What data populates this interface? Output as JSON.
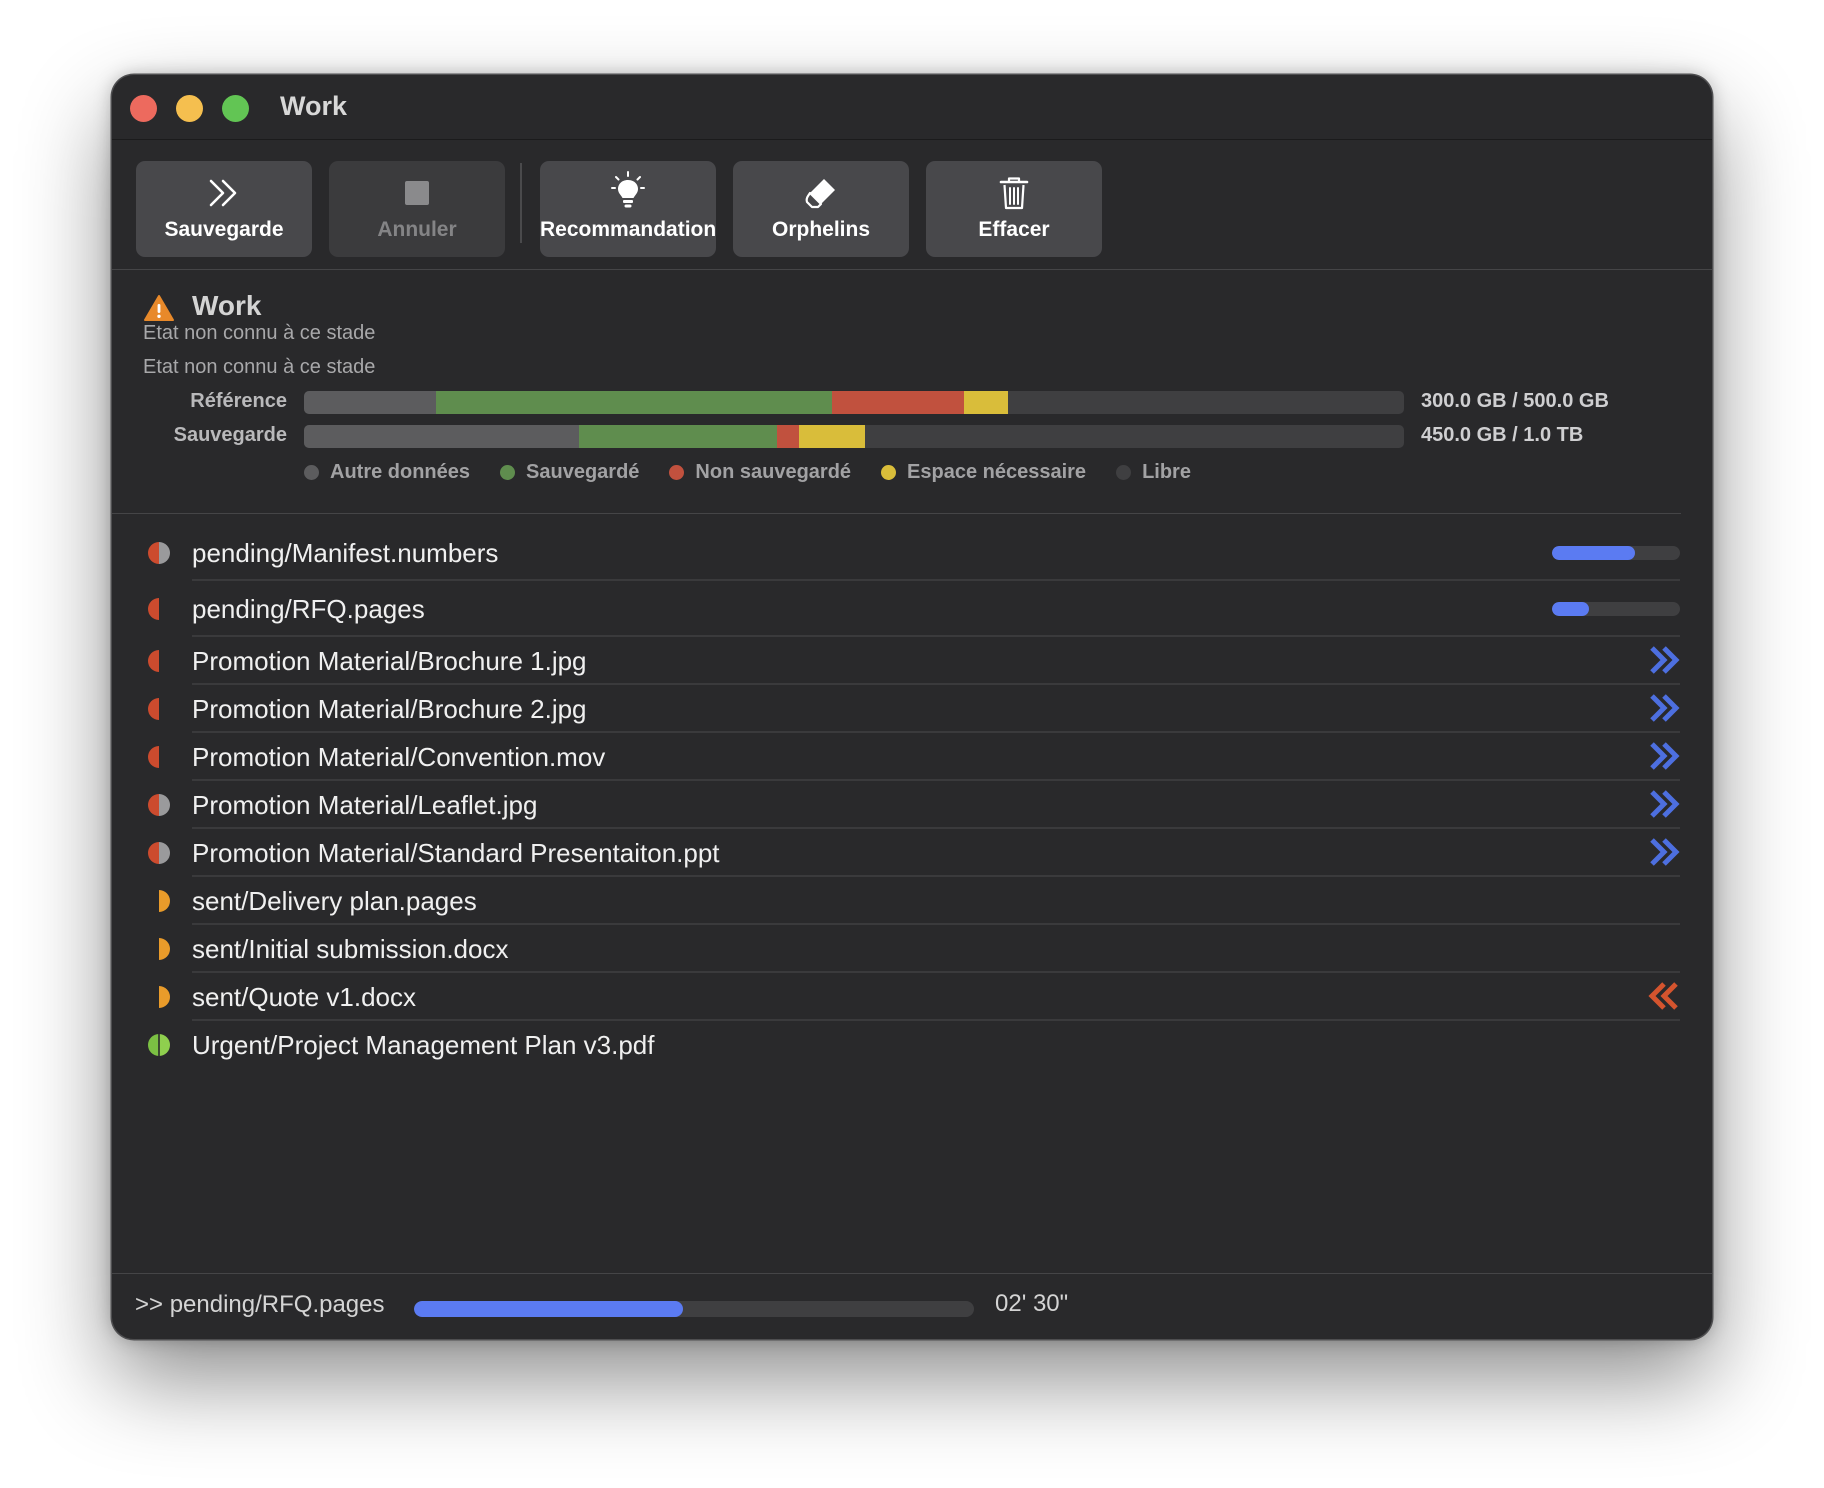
{
  "window": {
    "title": "Work"
  },
  "toolbar": {
    "buttons": [
      {
        "label": "Sauvegarde",
        "icon": "double-chevron-right-icon",
        "enabled": true
      },
      {
        "label": "Annuler",
        "icon": "stop-square-icon",
        "enabled": false
      },
      {
        "label": "Recommandation",
        "icon": "lightbulb-icon",
        "enabled": true
      },
      {
        "label": "Orphelins",
        "icon": "eraser-icon",
        "enabled": true
      },
      {
        "label": "Effacer",
        "icon": "trash-icon",
        "enabled": true
      }
    ]
  },
  "summary": {
    "title": "Work",
    "icon": "warning-triangle-icon",
    "status_lines": [
      "Etat non connu à ce stade",
      "Etat non connu à ce stade"
    ],
    "bars": [
      {
        "label": "Référence",
        "value_text": "300.0 GB / 500.0 GB",
        "segments": [
          {
            "key": "other",
            "fraction": 0.12
          },
          {
            "key": "saved",
            "fraction": 0.36
          },
          {
            "key": "unsaved",
            "fraction": 0.12
          },
          {
            "key": "needed",
            "fraction": 0.04
          }
        ]
      },
      {
        "label": "Sauvegarde",
        "value_text": "450.0 GB / 1.0 TB",
        "segments": [
          {
            "key": "other",
            "fraction": 0.25
          },
          {
            "key": "saved",
            "fraction": 0.18
          },
          {
            "key": "unsaved",
            "fraction": 0.02
          },
          {
            "key": "needed",
            "fraction": 0.06
          }
        ]
      }
    ],
    "legend": [
      {
        "key": "other",
        "label": "Autre données",
        "color": "#5c5c5e"
      },
      {
        "key": "saved",
        "label": "Sauvegardé",
        "color": "#5f8d4e"
      },
      {
        "key": "unsaved",
        "label": "Non sauvegardé",
        "color": "#c1513e"
      },
      {
        "key": "needed",
        "label": "Espace nécessaire",
        "color": "#d9bd3a"
      },
      {
        "key": "free",
        "label": "Libre",
        "color": "#3f3f41"
      }
    ]
  },
  "files": [
    {
      "name": "pending/Manifest.numbers",
      "icon": "half-circle-red-gray-icon",
      "status": "progress",
      "progress": 0.65
    },
    {
      "name": "pending/RFQ.pages",
      "icon": "half-circle-red-icon",
      "status": "progress",
      "progress": 0.29
    },
    {
      "name": "Promotion Material/Brochure 1.jpg",
      "icon": "half-circle-red-icon",
      "status": "upload",
      "arrow_icon": "double-chevron-right-icon"
    },
    {
      "name": "Promotion Material/Brochure 2.jpg",
      "icon": "half-circle-red-icon",
      "status": "upload",
      "arrow_icon": "double-chevron-right-icon"
    },
    {
      "name": "Promotion Material/Convention.mov",
      "icon": "half-circle-red-icon",
      "status": "upload",
      "arrow_icon": "double-chevron-right-icon"
    },
    {
      "name": "Promotion Material/Leaflet.jpg",
      "icon": "half-circle-red-gray-icon",
      "status": "upload",
      "arrow_icon": "double-chevron-right-icon"
    },
    {
      "name": "Promotion Material/Standard Presentaiton.ppt",
      "icon": "half-circle-red-gray-icon",
      "status": "upload",
      "arrow_icon": "double-chevron-right-icon"
    },
    {
      "name": "sent/Delivery plan.pages",
      "icon": "half-circle-orange-icon",
      "status": "none"
    },
    {
      "name": "sent/Initial submission.docx",
      "icon": "half-circle-orange-icon",
      "status": "none"
    },
    {
      "name": "sent/Quote v1.docx",
      "icon": "half-circle-orange-icon",
      "status": "restore",
      "arrow_icon": "double-chevron-left-icon"
    },
    {
      "name": "Urgent/Project Management Plan v3.pdf",
      "icon": "half-circle-green-icon",
      "status": "none"
    }
  ],
  "footer": {
    "current_file": ">> pending/RFQ.pages",
    "progress": 0.48,
    "eta": "02' 30\""
  },
  "colors": {
    "accent_blue": "#5b7bf2",
    "arrow_blue": "#4d6fe0",
    "arrow_orange": "#d4542e",
    "icon_red": "#cc4b2e",
    "icon_orange": "#e99b2a",
    "icon_green": "#7bc043",
    "icon_gray": "#9a9a9c",
    "warning": "#e8892a"
  }
}
